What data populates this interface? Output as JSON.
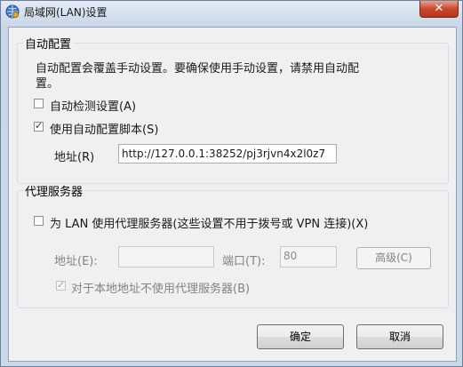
{
  "window": {
    "title": "局域网(LAN)设置",
    "close_label": "✕"
  },
  "auto_config": {
    "group_label": "自动配置",
    "description_line1": "自动配置会覆盖手动设置。要确保使用手动设置，请禁用自动配",
    "description_line2": "置。",
    "auto_detect": {
      "label": "自动检测设置(A)",
      "checked": false
    },
    "use_script": {
      "label": "使用自动配置脚本(S)",
      "checked": true
    },
    "address_label": "地址(R)",
    "address_value": "http://127.0.0.1:38252/pj3rjvn4x2l0z7"
  },
  "proxy": {
    "group_label": "代理服务器",
    "use_proxy": {
      "label": "为 LAN 使用代理服务器(这些设置不用于拨号或 VPN 连接)(X)",
      "checked": false
    },
    "address_label": "地址(E):",
    "address_value": "",
    "port_label": "端口(T):",
    "port_value": "80",
    "advanced_label": "高级(C)",
    "bypass_local": {
      "label": "对于本地地址不使用代理服务器(B)",
      "checked": true
    }
  },
  "buttons": {
    "ok": "确定",
    "cancel": "取消"
  }
}
